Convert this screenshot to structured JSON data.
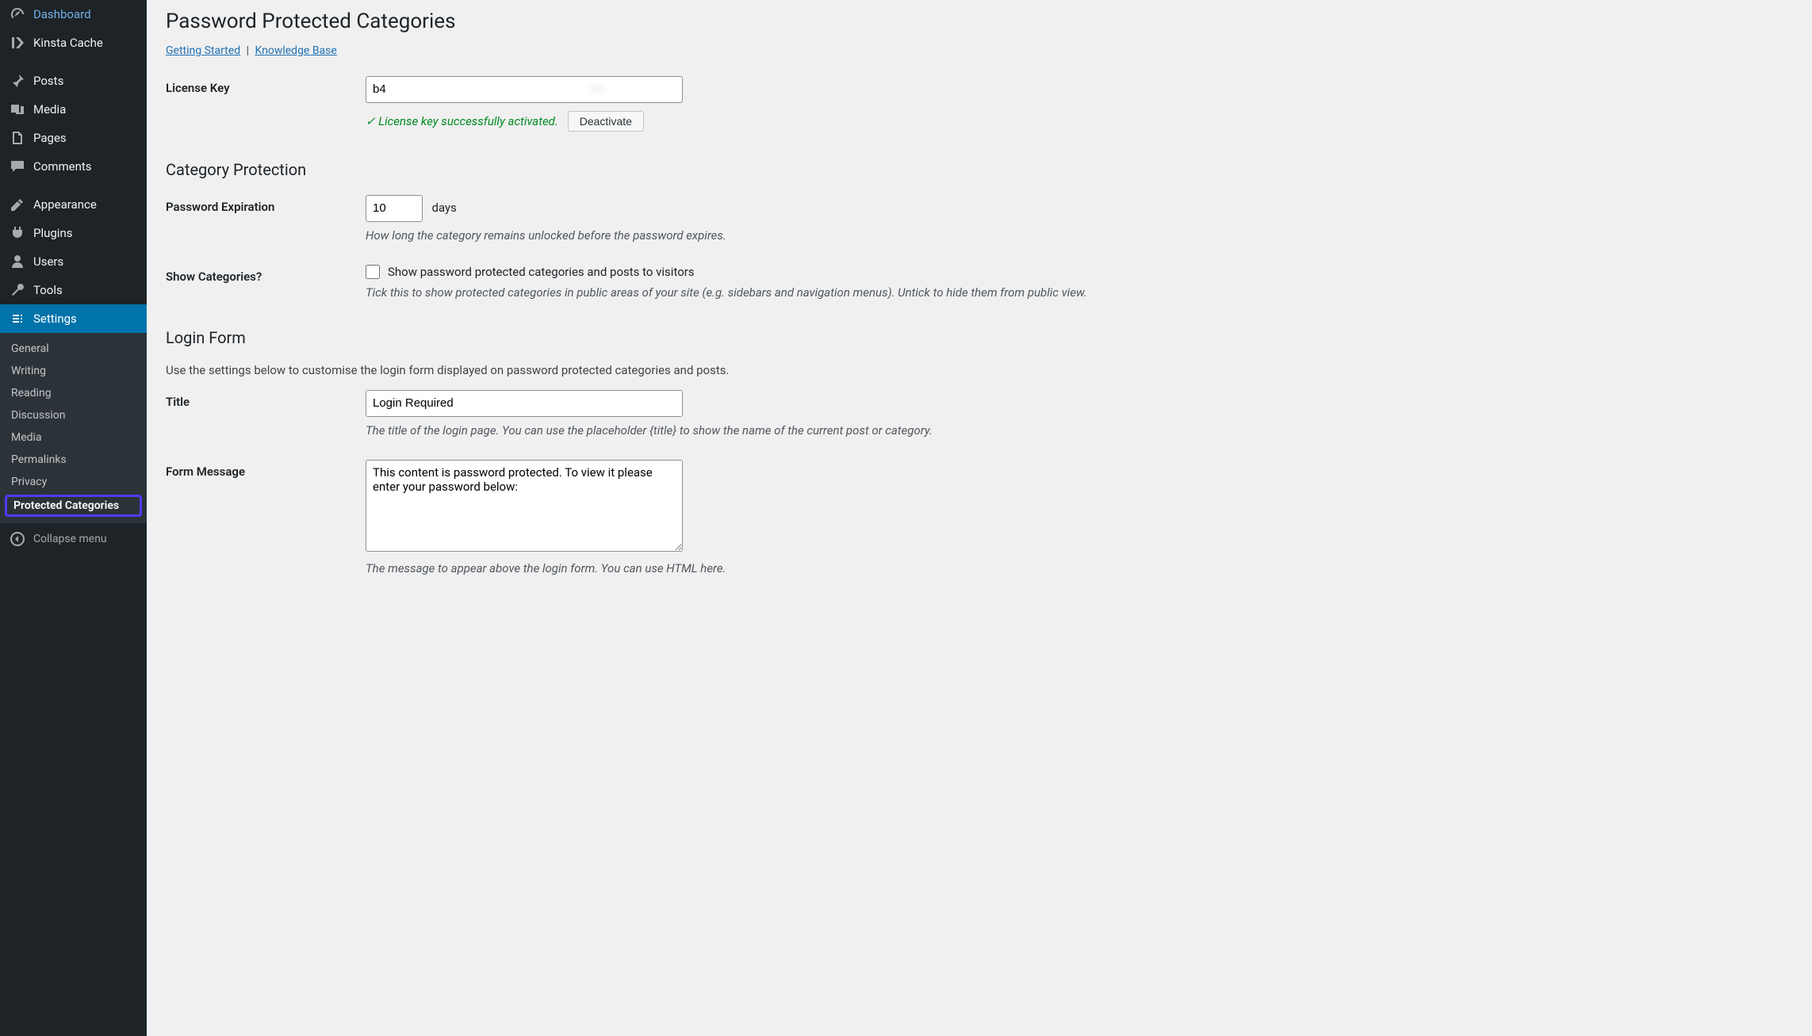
{
  "sidebar": {
    "items": [
      {
        "icon": "dashboard",
        "label": "Dashboard"
      },
      {
        "icon": "kinsta",
        "label": "Kinsta Cache"
      },
      {
        "icon": "pin",
        "label": "Posts"
      },
      {
        "icon": "media",
        "label": "Media"
      },
      {
        "icon": "pages",
        "label": "Pages"
      },
      {
        "icon": "comments",
        "label": "Comments"
      },
      {
        "icon": "appearance",
        "label": "Appearance"
      },
      {
        "icon": "plugins",
        "label": "Plugins"
      },
      {
        "icon": "users",
        "label": "Users"
      },
      {
        "icon": "tools",
        "label": "Tools"
      },
      {
        "icon": "settings",
        "label": "Settings"
      }
    ],
    "submenu": [
      "General",
      "Writing",
      "Reading",
      "Discussion",
      "Media",
      "Permalinks",
      "Privacy",
      "Protected Categories"
    ],
    "collapse": "Collapse menu"
  },
  "page": {
    "title": "Password Protected Categories",
    "link_getting_started": "Getting Started",
    "link_kb": "Knowledge Base",
    "license": {
      "label": "License Key",
      "value": "b4                                                              ba",
      "status": "✓ License key successfully activated.",
      "deactivate": "Deactivate"
    },
    "cat_protection": {
      "heading": "Category Protection",
      "expiration_label": "Password Expiration",
      "expiration_value": "10",
      "expiration_unit": "days",
      "expiration_desc": "How long the category remains unlocked before the password expires.",
      "show_label": "Show Categories?",
      "show_checkbox_label": "Show password protected categories and posts to visitors",
      "show_desc": "Tick this to show protected categories in public areas of your site (e.g. sidebars and navigation menus). Untick to hide them from public view."
    },
    "login_form": {
      "heading": "Login Form",
      "intro": "Use the settings below to customise the login form displayed on password protected categories and posts.",
      "title_label": "Title",
      "title_value": "Login Required",
      "title_desc": "The title of the login page. You can use the placeholder {title} to show the name of the current post or category.",
      "message_label": "Form Message",
      "message_value": "This content is password protected. To view it please enter your password below:",
      "message_desc": "The message to appear above the login form. You can use HTML here."
    }
  }
}
